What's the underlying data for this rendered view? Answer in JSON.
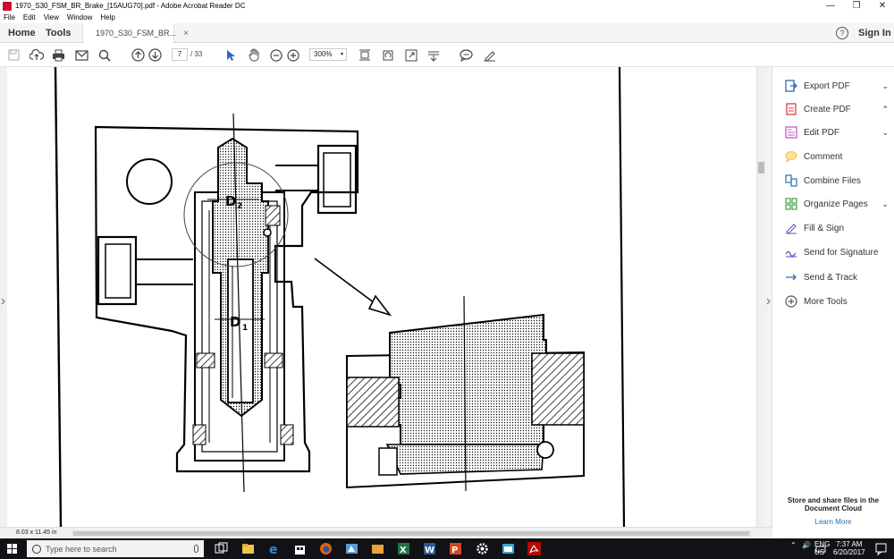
{
  "window": {
    "title": "1970_S30_FSM_BR_Brake_[15AUG70].pdf - Adobe Acrobat Reader DC",
    "controls": {
      "minimize": "—",
      "restore": "❐",
      "close": "✕"
    }
  },
  "menu": [
    "File",
    "Edit",
    "View",
    "Window",
    "Help"
  ],
  "tabs": {
    "home": "Home",
    "tools": "Tools",
    "document": "1970_S30_FSM_BR...",
    "close": "×"
  },
  "header": {
    "help": "?",
    "sign_in": "Sign In"
  },
  "toolbar": {
    "page_current": "7",
    "page_total": "/ 33",
    "zoom": "300%",
    "zoom_caret": "▾"
  },
  "right_pane": {
    "items": [
      {
        "label": "Export PDF",
        "chevron": "⌄",
        "color": "#2d6db5"
      },
      {
        "label": "Create PDF",
        "chevron": "⌃",
        "color": "#d93f3f"
      },
      {
        "label": "Edit PDF",
        "chevron": "⌄",
        "color": "#c75ac7"
      },
      {
        "label": "Comment",
        "chevron": "",
        "color": "#f5c342"
      },
      {
        "label": "Combine Files",
        "chevron": "",
        "color": "#2d6db5"
      },
      {
        "label": "Organize Pages",
        "chevron": "⌄",
        "color": "#3fa34d"
      },
      {
        "label": "Fill & Sign",
        "chevron": "",
        "color": "#7a5ac7"
      },
      {
        "label": "Send for Signature",
        "chevron": "",
        "color": "#5a4ac7"
      },
      {
        "label": "Send & Track",
        "chevron": "",
        "color": "#2d6db5"
      },
      {
        "label": "More Tools",
        "chevron": "",
        "color": "#555555"
      }
    ],
    "promo_text": "Store and share files in the Document Cloud",
    "learn_more": "Learn More"
  },
  "status": {
    "page_size": "8.03 x 11.45 in"
  },
  "taskbar": {
    "search_placeholder": "Type here to search",
    "lang": "ENG",
    "region": "US",
    "time": "7:37 AM",
    "date": "6/20/2017"
  }
}
